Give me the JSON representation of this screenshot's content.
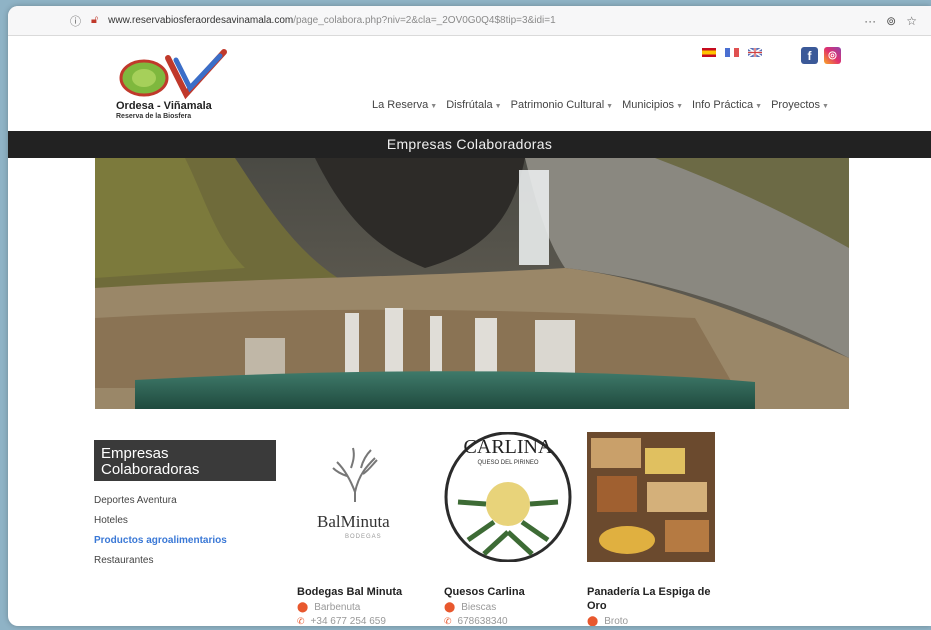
{
  "browser": {
    "url_host": "www.reservabiosferaordesavinamala.com",
    "url_path": "/page_colabora.php?niv=2&cla=_2OV0G0Q4$8tip=3&idi=1"
  },
  "logo": {
    "title": "Ordesa - Viñamala",
    "subtitle": "Reserva de la Biosfera"
  },
  "nav": [
    "La Reserva",
    "Disfrútala",
    "Patrimonio Cultural",
    "Municipios",
    "Info Práctica",
    "Proyectos"
  ],
  "page_title": "Empresas Colaboradoras",
  "sidebar": {
    "title": "Empresas Colaboradoras",
    "items": [
      {
        "label": "Deportes Aventura"
      },
      {
        "label": "Hoteles"
      },
      {
        "label": "Productos agroalimentarios"
      },
      {
        "label": "Restaurantes"
      }
    ]
  },
  "cards": [
    {
      "name": "Bodegas Bal Minuta",
      "place": "Barbenuta",
      "phone": "+34 677 254 659",
      "logo_text": "BalMinuta",
      "logo_sub": "BODEGAS"
    },
    {
      "name": "Quesos Carlina",
      "place": "Biescas",
      "phone": "678638340",
      "logo_text": "CARLINA",
      "logo_sub": "QUESO DEL PIRINEO"
    },
    {
      "name": "Panadería La Espiga de Oro",
      "place": "Broto",
      "phone": ""
    }
  ]
}
